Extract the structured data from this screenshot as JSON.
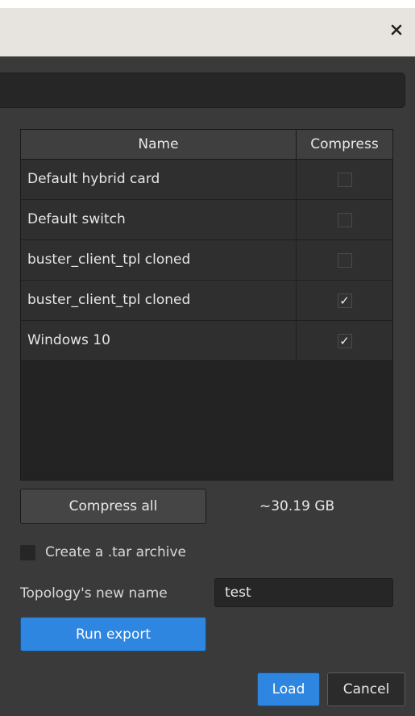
{
  "window": {
    "close_icon": "close-icon"
  },
  "search": {
    "value": ""
  },
  "table": {
    "headers": {
      "name": "Name",
      "compress": "Compress"
    },
    "rows": [
      {
        "name": "Default hybrid card",
        "compress": false,
        "mark": ""
      },
      {
        "name": "Default switch",
        "compress": false,
        "mark": ""
      },
      {
        "name": "buster_client_tpl cloned",
        "compress": false,
        "mark": ""
      },
      {
        "name": "buster_client_tpl cloned",
        "compress": true,
        "mark": "✓"
      },
      {
        "name": "Windows 10",
        "compress": true,
        "mark": "✓"
      }
    ]
  },
  "actions": {
    "compress_all_label": "Compress all",
    "estimated_size": "~30.19 GB",
    "tar_archive_label": "Create a .tar archive",
    "tar_archive_checked": false,
    "new_name_label": "Topology's new name",
    "new_name_value": "test",
    "run_export_label": "Run export"
  },
  "footer": {
    "load_label": "Load",
    "cancel_label": "Cancel"
  },
  "colors": {
    "accent": "#2f86e0",
    "panel_bg": "#3a3a3a",
    "titlebar_bg": "#e7e3df"
  }
}
